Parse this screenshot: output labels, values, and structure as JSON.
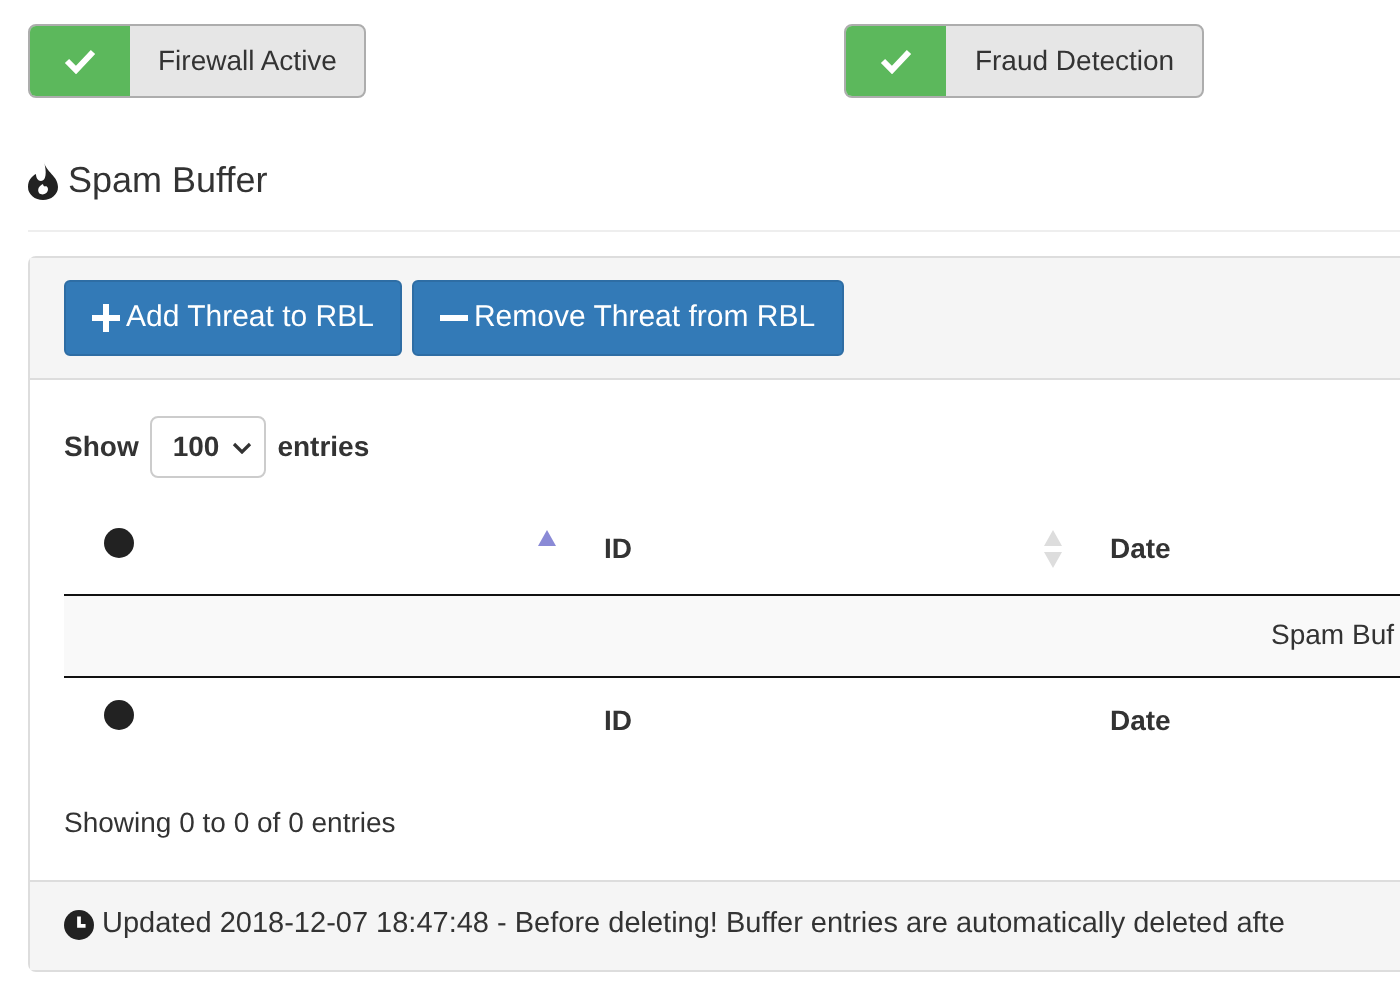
{
  "toggles": [
    {
      "label": "Firewall Active",
      "on": true
    },
    {
      "label": "Fraud Detection",
      "on": true
    }
  ],
  "section_title": "Spam Buffer",
  "toolbar": [
    {
      "label": "Add Threat to RBL",
      "kind": "add"
    },
    {
      "label": "Remove Threat from RBL",
      "kind": "remove"
    }
  ],
  "length_menu": {
    "prefix": "Show",
    "value": "100",
    "suffix": "entries"
  },
  "table": {
    "columns": [
      {
        "kind": "dot",
        "sortable": true,
        "sorted": true
      },
      {
        "label": "ID",
        "kind": "text",
        "sortable": true,
        "sorted": false
      },
      {
        "label": "Date",
        "kind": "text"
      }
    ],
    "empty_message": "Spam Buf",
    "footer": [
      {
        "kind": "dot"
      },
      {
        "label": "ID",
        "kind": "text"
      },
      {
        "label": "Date",
        "kind": "text"
      }
    ]
  },
  "info": "Showing 0 to 0 of 0 entries",
  "panel_footer": "Updated 2018-12-07 18:47:48 - Before deleting! Buffer entries are automatically deleted afte"
}
